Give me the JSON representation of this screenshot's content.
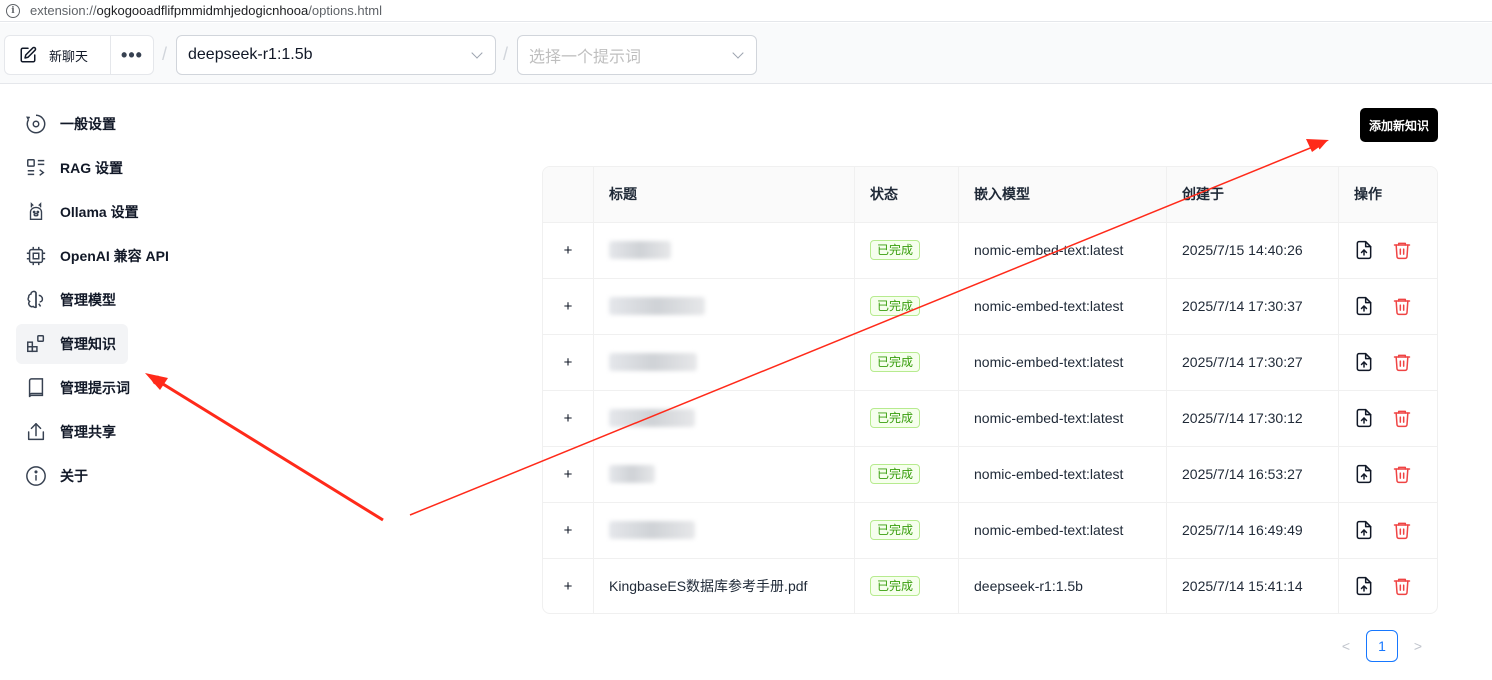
{
  "browser": {
    "url_scheme": "extension://",
    "url_host": "ogkogooadflifpmmidmhjedogicnhooa",
    "url_path": "/options.html"
  },
  "header": {
    "new_chat_label": "新聊天",
    "more_label": "•••",
    "separator": "/",
    "model_select": "deepseek-r1:1.5b",
    "prompt_select_placeholder": "选择一个提示词"
  },
  "sidebar": {
    "items": [
      {
        "label": "一般设置",
        "icon": "gear-icon"
      },
      {
        "label": "RAG 设置",
        "icon": "rag-icon"
      },
      {
        "label": "Ollama 设置",
        "icon": "llama-icon"
      },
      {
        "label": "OpenAI 兼容 API",
        "icon": "cpu-icon"
      },
      {
        "label": "管理模型",
        "icon": "brain-icon"
      },
      {
        "label": "管理知识",
        "icon": "blocks-icon"
      },
      {
        "label": "管理提示词",
        "icon": "book-icon"
      },
      {
        "label": "管理共享",
        "icon": "share-icon"
      },
      {
        "label": "关于",
        "icon": "info-icon"
      }
    ],
    "active_index": 5
  },
  "main": {
    "add_button_label": "添加新知识",
    "table": {
      "columns": [
        "",
        "标题",
        "状态",
        "嵌入模型",
        "创建于",
        "操作"
      ],
      "rows": [
        {
          "expand": "+",
          "title": "",
          "status": "已完成",
          "model": "nomic-embed-text:latest",
          "created": "2025/7/15 14:40:26"
        },
        {
          "expand": "+",
          "title": "",
          "status": "已完成",
          "model": "nomic-embed-text:latest",
          "created": "2025/7/14 17:30:37"
        },
        {
          "expand": "+",
          "title": "",
          "status": "已完成",
          "model": "nomic-embed-text:latest",
          "created": "2025/7/14 17:30:27"
        },
        {
          "expand": "+",
          "title": "",
          "status": "已完成",
          "model": "nomic-embed-text:latest",
          "created": "2025/7/14 17:30:12"
        },
        {
          "expand": "+",
          "title": "",
          "status": "已完成",
          "model": "nomic-embed-text:latest",
          "created": "2025/7/14 16:53:27"
        },
        {
          "expand": "+",
          "title": "",
          "status": "已完成",
          "model": "nomic-embed-text:latest",
          "created": "2025/7/14 16:49:49"
        },
        {
          "expand": "+",
          "title": "KingbaseES数据库参考手册.pdf",
          "status": "已完成",
          "model": "deepseek-r1:1.5b",
          "created": "2025/7/14 15:41:14"
        }
      ]
    },
    "pagination": {
      "prev": "<",
      "current": "1",
      "next": ">"
    }
  },
  "colors": {
    "accent_black": "#000000",
    "status_green": "#389e0d",
    "delete_red": "#ef4444",
    "annotation_red": "#ff2a1a",
    "pager_blue": "#1677ff"
  }
}
